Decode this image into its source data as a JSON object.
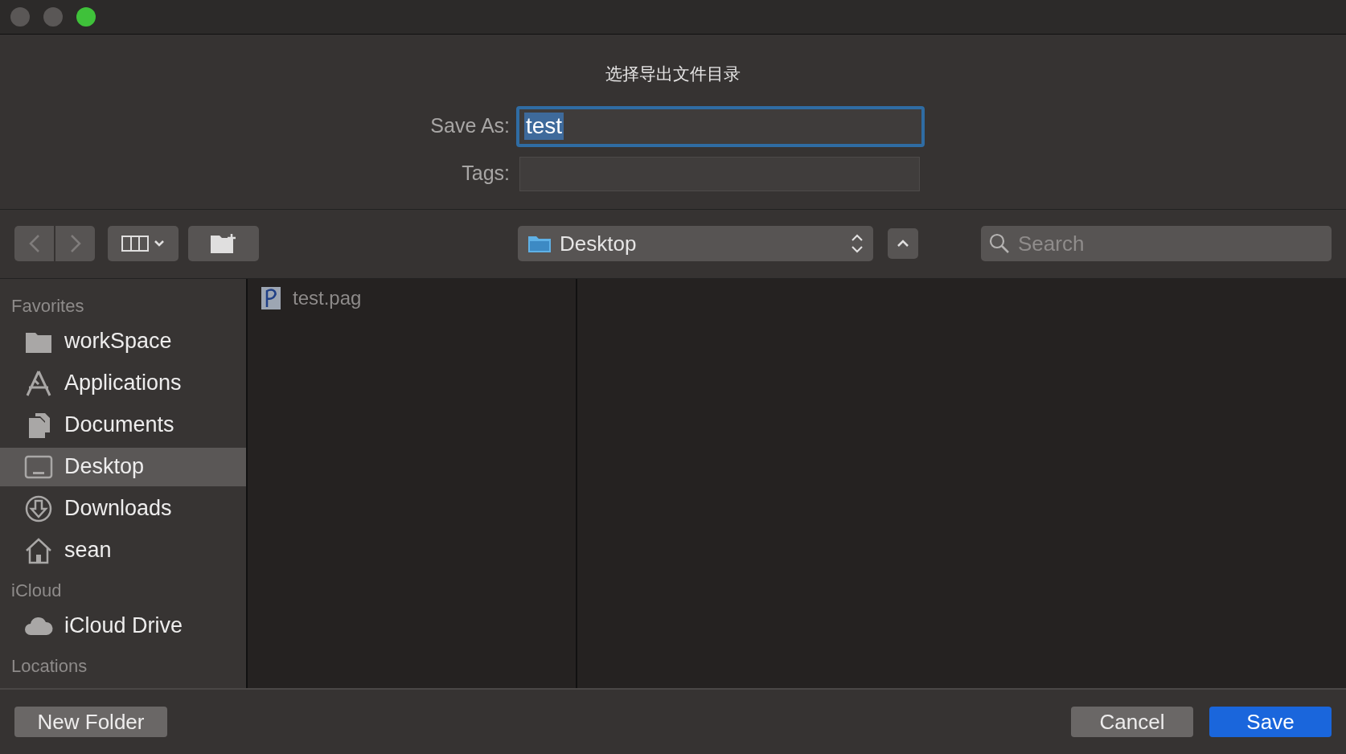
{
  "window": {
    "title": "选择导出文件目录"
  },
  "save_as": {
    "label": "Save As:",
    "value": "test"
  },
  "tags": {
    "label": "Tags:"
  },
  "toolbar": {
    "location": "Desktop",
    "search": {
      "placeholder": "Search"
    }
  },
  "sidebar": {
    "sections": [
      {
        "title": "Favorites",
        "items": [
          {
            "label": "workSpace",
            "kind": "folder",
            "selected": false
          },
          {
            "label": "Applications",
            "kind": "apps",
            "selected": false
          },
          {
            "label": "Documents",
            "kind": "documents",
            "selected": false
          },
          {
            "label": "Desktop",
            "kind": "desktop",
            "selected": true
          },
          {
            "label": "Downloads",
            "kind": "downloads",
            "selected": false
          },
          {
            "label": "sean",
            "kind": "home",
            "selected": false
          }
        ]
      },
      {
        "title": "iCloud",
        "items": [
          {
            "label": "iCloud Drive",
            "kind": "cloud",
            "selected": false
          }
        ]
      },
      {
        "title": "Locations"
      }
    ]
  },
  "files": [
    {
      "name": "test.pag"
    }
  ],
  "buttons": {
    "new_folder": "New Folder",
    "cancel": "Cancel",
    "save": "Save"
  }
}
